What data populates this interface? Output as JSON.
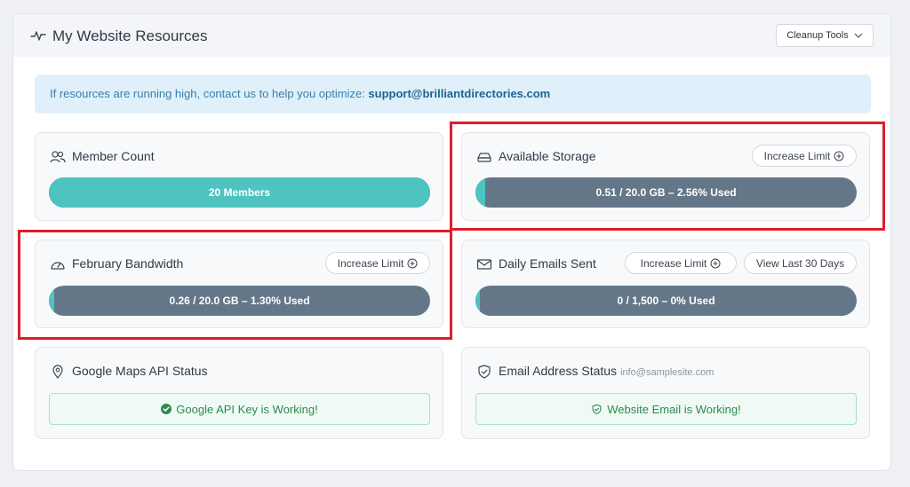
{
  "header": {
    "title": "My Website Resources",
    "cleanup_label": "Cleanup Tools"
  },
  "info": {
    "text": "If resources are running high, contact us to help you optimize: ",
    "email": "support@brilliantdirectories.com"
  },
  "member_count": {
    "title": "Member Count",
    "bar_label": "20 Members",
    "fill_fraction": 1.0
  },
  "storage": {
    "title": "Available Storage",
    "increase_label": "Increase Limit",
    "bar_label": "0.51 / 20.0 GB – 2.56% Used",
    "fill_fraction": 0.0256
  },
  "bandwidth": {
    "title": "February Bandwidth",
    "increase_label": "Increase Limit",
    "bar_label": "0.26 / 20.0 GB – 1.30% Used",
    "fill_fraction": 0.013
  },
  "emails": {
    "title": "Daily Emails Sent",
    "increase_label": "Increase Limit",
    "view_label": "View Last 30 Days",
    "bar_label": "0 / 1,500 – 0% Used",
    "fill_fraction": 0.0
  },
  "maps": {
    "title": "Google Maps API Status",
    "status": "Google API Key is Working!"
  },
  "email_status": {
    "title": "Email Address Status",
    "address": "info@samplesite.com",
    "status": "Website Email is Working!"
  },
  "colors": {
    "accent_teal": "#4ec3bf",
    "bar_slate": "#647789",
    "highlight_red": "#dd1f2a",
    "success_green": "#2f8a50"
  }
}
